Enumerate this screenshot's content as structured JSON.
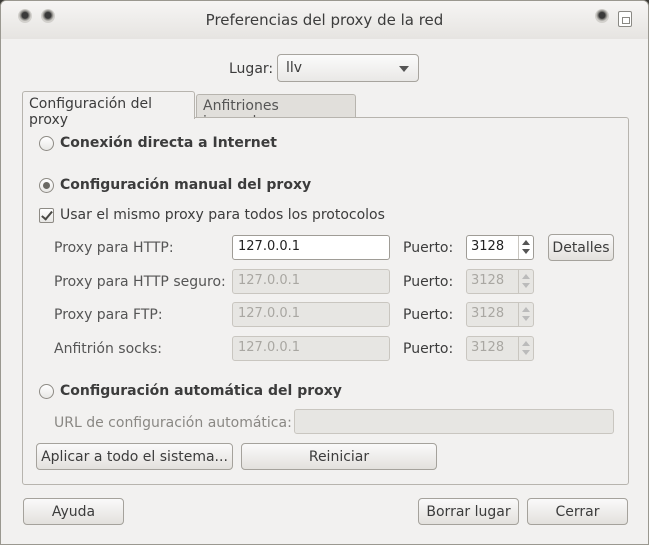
{
  "window": {
    "title": "Preferencias del proxy de la red"
  },
  "location": {
    "label": "Lugar:",
    "value": "llv"
  },
  "tabs": [
    {
      "label": "Configuración del proxy",
      "active": true
    },
    {
      "label": "Anfitriones ignorados",
      "active": false
    }
  ],
  "proxy": {
    "direct_label": "Conexión directa a Internet",
    "manual_label": "Configuración manual del proxy",
    "same_proxy_label": "Usar el mismo proxy para todos los protocolos",
    "rows": [
      {
        "label": "Proxy para HTTP:",
        "host": "127.0.0.1",
        "port_label": "Puerto:",
        "port": "3128",
        "enabled": true
      },
      {
        "label": "Proxy para HTTP seguro:",
        "host": "127.0.0.1",
        "port_label": "Puerto:",
        "port": "3128",
        "enabled": false
      },
      {
        "label": "Proxy para FTP:",
        "host": "127.0.0.1",
        "port_label": "Puerto:",
        "port": "3128",
        "enabled": false
      },
      {
        "label": "Anfitrión socks:",
        "host": "127.0.0.1",
        "port_label": "Puerto:",
        "port": "3128",
        "enabled": false
      }
    ],
    "details_label": "Detalles",
    "auto_label": "Configuración automática del proxy",
    "auto_url_label": "URL de configuración automática:",
    "auto_url_value": ""
  },
  "actions": {
    "apply_system": "Aplicar a todo el sistema...",
    "reset": "Reiniciar",
    "help": "Ayuda",
    "delete_location": "Borrar lugar",
    "close": "Cerrar"
  }
}
